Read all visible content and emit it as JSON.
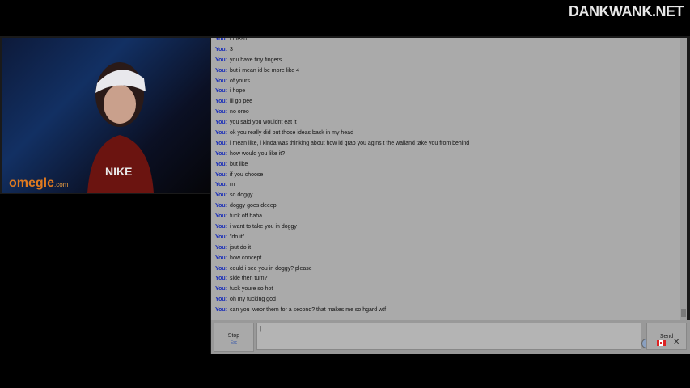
{
  "watermark": "DANKWANK.NET",
  "logo": {
    "main": "omegle",
    "suffix": ".com"
  },
  "chat": {
    "sender_label": "You:",
    "messages": [
      "i mean",
      "3",
      "you have tiny fingers",
      "but i mean id be more like 4",
      "of yours",
      "i hope",
      "ill go pee",
      "no oreo",
      "you said you wouldnt eat it",
      "ok you really did put those ideas back in my head",
      "i mean like, i kinda was thinking about how id grab you agins t the walland take you from behind",
      "how would you like it?",
      "but like",
      "if you choose",
      "rn",
      "so doggy",
      "doggy goes deeep",
      "fuck off haha",
      "i want to take you in doggy",
      "\"do it\"",
      "jsut do it",
      "how concept",
      "could i see you in doggy? please",
      "side then turn?",
      "fuck youre so hot",
      "oh my fucking god",
      "can you lweor them for a second? that makes me so hgard wtf"
    ]
  },
  "controls": {
    "stop_label": "Stop",
    "stop_hint": "Esc",
    "send_label": "Send",
    "input_value": "|",
    "close_symbol": "✕"
  },
  "icons": {
    "flag": "canada-flag-icon",
    "close": "close-icon",
    "record": "record-icon"
  },
  "colors": {
    "chat_bg": "#aaaaaa",
    "sender": "#1b2fb8",
    "logo": "#e07a1f"
  }
}
